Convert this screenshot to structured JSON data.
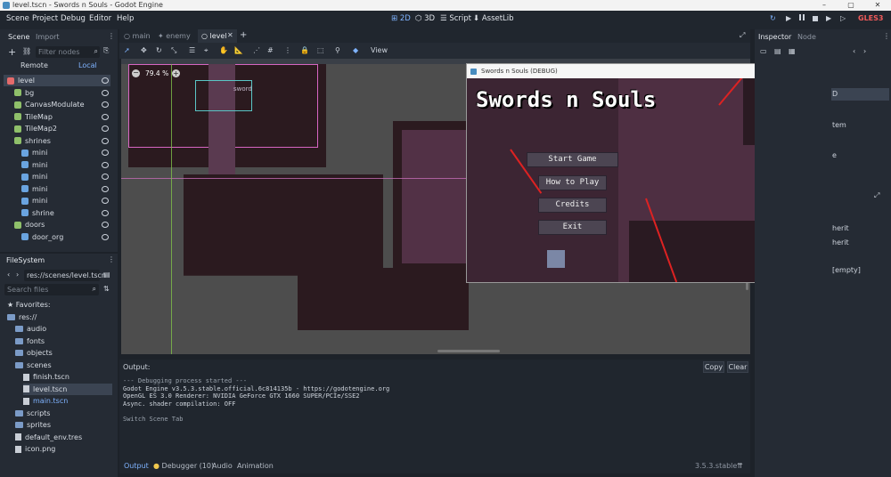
{
  "window": {
    "title": "level.tscn - Swords n Souls - Godot Engine"
  },
  "menubar": {
    "items": [
      "Scene",
      "Project",
      "Debug",
      "Editor",
      "Help"
    ],
    "workspaces": [
      "2D",
      "3D",
      "Script",
      "AssetLib"
    ],
    "renderer": "GLES3"
  },
  "scene_dock": {
    "tabs": [
      "Scene",
      "Import"
    ],
    "filter_placeholder": "Filter nodes",
    "remote": "Remote",
    "local": "Local",
    "nodes": [
      {
        "label": "level",
        "depth": 0,
        "selected": true
      },
      {
        "label": "bg",
        "depth": 1
      },
      {
        "label": "CanvasModulate",
        "depth": 1
      },
      {
        "label": "TileMap",
        "depth": 1
      },
      {
        "label": "TileMap2",
        "depth": 1
      },
      {
        "label": "shrines",
        "depth": 1
      },
      {
        "label": "mini",
        "depth": 2
      },
      {
        "label": "mini",
        "depth": 2
      },
      {
        "label": "mini",
        "depth": 2
      },
      {
        "label": "mini",
        "depth": 2
      },
      {
        "label": "mini",
        "depth": 2
      },
      {
        "label": "shrine",
        "depth": 2
      },
      {
        "label": "doors",
        "depth": 1
      },
      {
        "label": "door_org",
        "depth": 2
      }
    ]
  },
  "filesystem": {
    "title": "FileSystem",
    "path": "res://scenes/level.tscn",
    "search_placeholder": "Search files",
    "items": [
      {
        "label": "Favorites:",
        "type": "fav",
        "depth": 0
      },
      {
        "label": "res://",
        "type": "folder",
        "depth": 0
      },
      {
        "label": "audio",
        "type": "folder",
        "depth": 1
      },
      {
        "label": "fonts",
        "type": "folder",
        "depth": 1
      },
      {
        "label": "objects",
        "type": "folder",
        "depth": 1
      },
      {
        "label": "scenes",
        "type": "folder",
        "depth": 1
      },
      {
        "label": "finish.tscn",
        "type": "file",
        "depth": 2
      },
      {
        "label": "level.tscn",
        "type": "file",
        "depth": 2,
        "selected": true
      },
      {
        "label": "main.tscn",
        "type": "file",
        "depth": 2,
        "link": true
      },
      {
        "label": "scripts",
        "type": "folder",
        "depth": 1
      },
      {
        "label": "sprites",
        "type": "folder",
        "depth": 1
      },
      {
        "label": "default_env.tres",
        "type": "file",
        "depth": 1
      },
      {
        "label": "icon.png",
        "type": "file",
        "depth": 1
      }
    ]
  },
  "editor_tabs": [
    "main",
    "enemy",
    "level"
  ],
  "toolbar": {
    "view_label": "View",
    "zoom": "79.4 %"
  },
  "viewport": {
    "node_label": "sword"
  },
  "game_window": {
    "title": "Swords n Souls (DEBUG)",
    "logo": "Swords n Souls",
    "buttons": [
      "Start Game",
      "How to Play",
      "Credits",
      "Exit"
    ]
  },
  "output": {
    "label": "Output:",
    "copy": "Copy",
    "clear": "Clear",
    "lines": [
      "--- Debugging process started ---",
      "Godot Engine v3.5.3.stable.official.6c814135b - https://godotengine.org",
      "OpenGL ES 3.0 Renderer: NVIDIA GeForce GTX 1660 SUPER/PCIe/SSE2",
      "Async. shader compilation: OFF",
      "",
      "Switch Scene Tab"
    ]
  },
  "bottom_panel": {
    "tabs": [
      "Output",
      "Debugger (10)",
      "Audio",
      "Animation"
    ],
    "version": "3.5.3.stable"
  },
  "inspector": {
    "tabs": [
      "Inspector",
      "Node"
    ],
    "fragments": [
      "D",
      "tem",
      "e",
      "herit",
      "herit",
      "[empty]"
    ]
  }
}
